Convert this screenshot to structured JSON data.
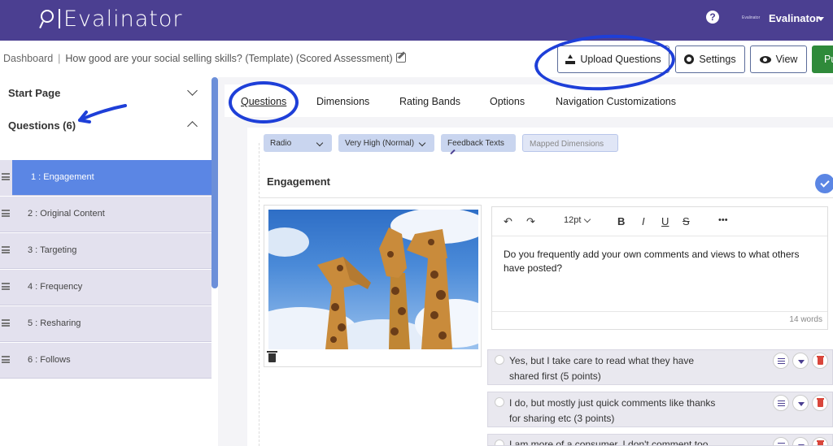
{
  "app": {
    "name": "Evalinator",
    "mini_logo": "Evalinator"
  },
  "header": {
    "help": "?",
    "user_name": "Evalinator"
  },
  "breadcrumb": {
    "home": "Dashboard",
    "separator": "|",
    "title": "How good are your social selling skills? (Template) (Scored Assessment)"
  },
  "toolbar": {
    "upload_label": "Upload Questions",
    "settings_label": "Settings",
    "view_label": "View",
    "publish_label": "Pu"
  },
  "sidebar": {
    "start_page": "Start Page",
    "questions_header": "Questions (6)",
    "items": [
      {
        "label": "1 : Engagement"
      },
      {
        "label": "2 : Original Content"
      },
      {
        "label": "3 : Targeting"
      },
      {
        "label": "4 : Frequency"
      },
      {
        "label": "5 : Resharing"
      },
      {
        "label": "6 : Follows"
      }
    ]
  },
  "tabs": [
    {
      "label": "Questions"
    },
    {
      "label": "Dimensions"
    },
    {
      "label": "Rating Bands"
    },
    {
      "label": "Options"
    },
    {
      "label": "Navigation Customizations"
    }
  ],
  "question": {
    "chips": {
      "type": "Radio",
      "importance": "Very High (Normal)",
      "feedback": "Feedback Texts",
      "mapped": "Mapped Dimensions"
    },
    "title": "Engagement",
    "editor": {
      "font_size": "12pt",
      "bold": "B",
      "italic": "I",
      "underline": "U",
      "strike": "S",
      "more": "•••",
      "undo": "↶",
      "redo": "↷",
      "text": "Do you frequently add your own comments and views to what others have posted?",
      "word_count": "14 words"
    },
    "answers": [
      {
        "text": "Yes, but I take care to read what they have shared first (5  points)"
      },
      {
        "text": "I do, but mostly just quick comments like thanks for sharing etc (3  points)"
      },
      {
        "text": "I am more of a consumer. I don't comment too"
      }
    ]
  },
  "colors": {
    "header_bg": "#4b3f91",
    "active_item": "#5b86e4",
    "annotation": "#1e3fd8",
    "publish": "#2f8a3a",
    "delete": "#d9463b"
  }
}
